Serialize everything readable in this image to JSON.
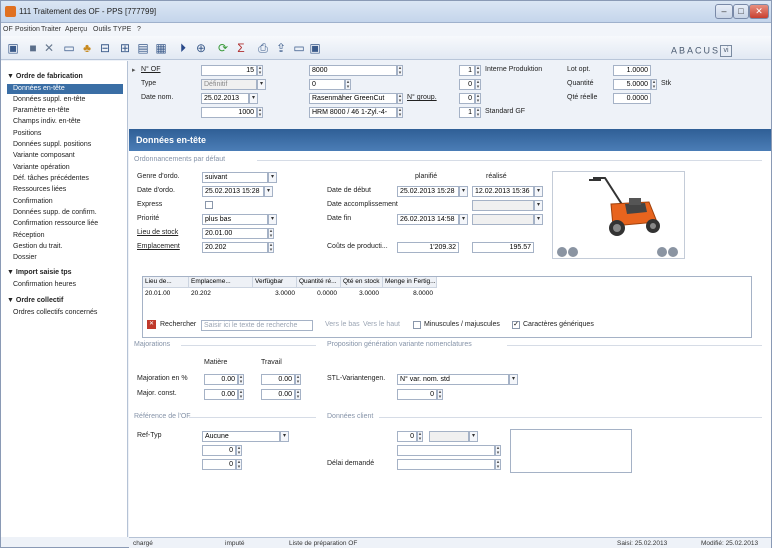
{
  "window": {
    "title": "111 Traitement des OF - PPS [777799]"
  },
  "menu": [
    "OF",
    "Position",
    "Traiter",
    "Aperçu",
    "Outils",
    "TYPE",
    "?"
  ],
  "brand": "ABACUS",
  "brand_suffix": "vi",
  "sidebar": {
    "group1": "▼ Ordre de fabrication",
    "items1": [
      "Données en-tête",
      "Données suppl. en-tête",
      "Paramètre en-tête",
      "Champs indiv. en-tête",
      "Positions",
      "Données suppl. positions",
      "Variante composant",
      "Variante opération",
      "Déf. tâches précédentes",
      "Ressources liées",
      "Confirmation",
      "Données supp. de confirm.",
      "Confirmation ressource liée",
      "Réception",
      "Gestion du trait.",
      "Dossier"
    ],
    "group2": "▼ Import saisie tps",
    "items2": [
      "Confirmation heures"
    ],
    "group3": "▼ Ordre collectif",
    "items3": [
      "Ordres collectifs concernés"
    ]
  },
  "header": {
    "no_of_label": "N° OF",
    "no_of": "15",
    "article": "8000",
    "qty1": "1",
    "interne": "Interne Produktion",
    "lotopt_label": "Lot opt.",
    "lotopt": "1.0000",
    "type_label": "Type",
    "type": "Définitif",
    "f2": "0",
    "qty2": "0",
    "quantite_label": "Quantité",
    "quantite": "5.0000",
    "unit": "Stk",
    "datenom_label": "Date nom.",
    "datenom": "25.02.2013",
    "desc": "Rasenmäher GreenCut",
    "ngroup_label": "N° group.",
    "qty3": "0",
    "qtereelle_label": "Qté réelle",
    "qtereelle": "0.0000",
    "f4": "1000",
    "model": "HRM 8000 / 46 1-Zyl.-4-",
    "qty4": "1",
    "standard": "Standard GF"
  },
  "panel": {
    "title": "Données en-tête",
    "sec1": "Ordonnancements par défaut",
    "genre_label": "Genre d'ordo.",
    "genre": "suivant",
    "planifie": "planifié",
    "realise": "réalisé",
    "dateordo_label": "Date d'ordo.",
    "dateordo": "25.02.2013 15:28",
    "datedebut_label": "Date de début",
    "datedebut_plan": "25.02.2013 15:28",
    "datedebut_real": "12.02.2013 15:36",
    "express_label": "Express",
    "dateaccomp_label": "Date accomplissement",
    "priorite_label": "Priorité",
    "priorite": "plus bas",
    "datefin_label": "Date fin",
    "datefin": "26.02.2013 14:58",
    "lieu_label": "Lieu de stock",
    "lieu": "20.01.00",
    "empl_label": "Emplacement",
    "empl": "20.202",
    "couts_label": "Coûts de producti...",
    "couts1": "1'209.32",
    "couts2": "195.57",
    "grid_headers": [
      "Lieu de...",
      "Emplaceme...",
      "Verfügbar",
      "Quantité ré...",
      "Qté en stock",
      "Menge in Fertig..."
    ],
    "grid_row": [
      "20.01.00",
      "20.202",
      "3.0000",
      "0.0000",
      "3.0000",
      "8.0000"
    ],
    "rechercher": "Rechercher",
    "search_ph": "Saisir ici le texte de recherche",
    "vers_bas": "Vers le bas",
    "vers_haut": "Vers le haut",
    "minmaj": "Minuscules / majuscules",
    "generiques": "Caractères génériques",
    "sec2": "Majorations",
    "sec3": "Proposition génération variante nomenclatures",
    "matiere": "Matière",
    "travail": "Travail",
    "majpct_label": "Majoration en %",
    "majpct1": "0.00",
    "majpct2": "0.00",
    "majconst_label": "Major. const.",
    "majconst1": "0.00",
    "majconst2": "0.00",
    "stl_label": "STL-Variantengen.",
    "stl": "N° var. nom. std",
    "stl_val": "0",
    "sec4": "Référence de l'OF",
    "sec5": "Données client",
    "reftyp_label": "Ref-Typ",
    "reftyp": "Aucune",
    "ref1": "0",
    "ref2": "0",
    "client_val": "0",
    "delai_label": "Délai demandé"
  },
  "status": [
    "chargé",
    "imputé",
    "Liste de préparation OF",
    "Saisi: 25.02.2013",
    "Modifié: 25.02.2013"
  ]
}
